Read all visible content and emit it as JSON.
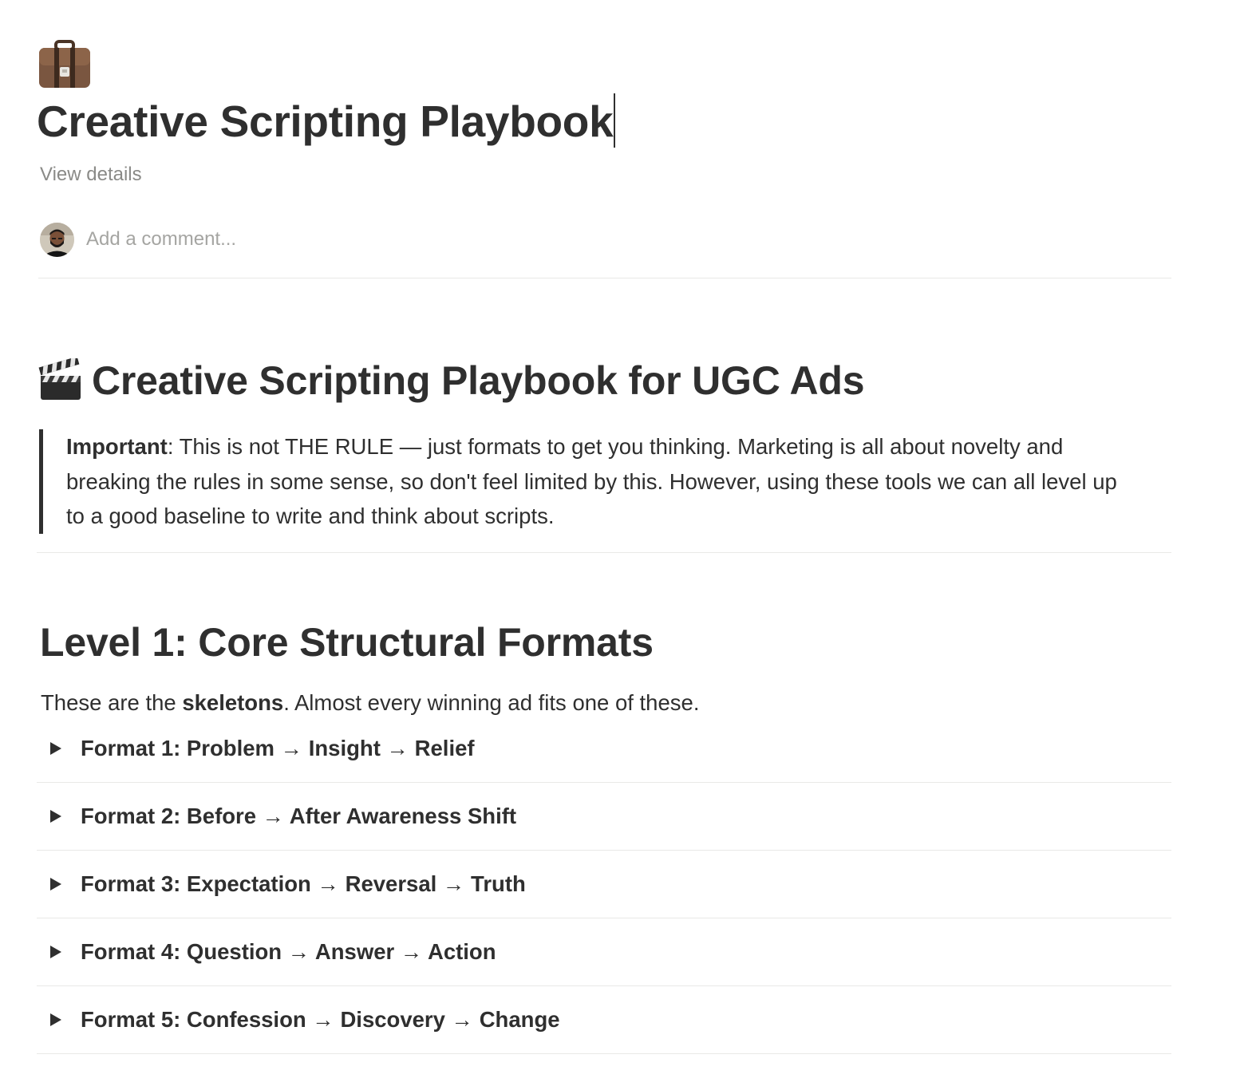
{
  "page": {
    "icon": "briefcase-icon",
    "title": "Creative Scripting Playbook",
    "view_details_label": "View details"
  },
  "comment": {
    "avatar": "user-avatar",
    "placeholder": "Add a comment..."
  },
  "section1": {
    "icon": "clapper-board-icon",
    "heading": "Creative Scripting Playbook for UGC Ads",
    "callout": {
      "bold": "Important",
      "text": ": This is not THE RULE — just formats to get you thinking. Marketing is all about novelty and breaking the rules in some sense, so don't feel limited by this. However, using these tools we can all level up to a good baseline to write and think about scripts."
    }
  },
  "section2": {
    "heading": "Level 1: Core Structural Formats",
    "intro_pre": "These are the ",
    "intro_bold": "skeletons",
    "intro_post": ". Almost every winning ad fits one of these.",
    "toggles": [
      {
        "label": "Format 1: Problem → Insight → Relief"
      },
      {
        "label": "Format 2: Before → After Awareness Shift"
      },
      {
        "label": "Format 3: Expectation → Reversal → Truth"
      },
      {
        "label": "Format 4: Question → Answer → Action"
      },
      {
        "label": "Format 5: Confession → Discovery → Change"
      }
    ]
  }
}
